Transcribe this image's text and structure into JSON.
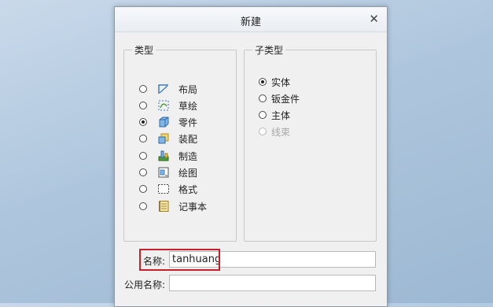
{
  "dialog": {
    "title": "新建",
    "close_glyph": "✕"
  },
  "type_group": {
    "legend": "类型",
    "items": [
      {
        "label": "布局",
        "icon": "layout-icon",
        "selected": false
      },
      {
        "label": "草绘",
        "icon": "sketch-icon",
        "selected": false
      },
      {
        "label": "零件",
        "icon": "part-icon",
        "selected": true
      },
      {
        "label": "装配",
        "icon": "assembly-icon",
        "selected": false
      },
      {
        "label": "制造",
        "icon": "manufacturing-icon",
        "selected": false
      },
      {
        "label": "绘图",
        "icon": "drawing-icon",
        "selected": false
      },
      {
        "label": "格式",
        "icon": "format-icon",
        "selected": false
      },
      {
        "label": "记事本",
        "icon": "notebook-icon",
        "selected": false
      }
    ]
  },
  "subtype_group": {
    "legend": "子类型",
    "items": [
      {
        "label": "实体",
        "selected": true,
        "enabled": true
      },
      {
        "label": "钣金件",
        "selected": false,
        "enabled": true
      },
      {
        "label": "主体",
        "selected": false,
        "enabled": true
      },
      {
        "label": "线束",
        "selected": false,
        "enabled": false
      }
    ]
  },
  "name_field": {
    "label": "名称:",
    "value": "tanhuang"
  },
  "common_name_field": {
    "label": "公用名称:",
    "value": ""
  },
  "colors": {
    "highlight": "#c8202a",
    "icon_blue": "#3a78c2",
    "icon_green": "#4c9a3a",
    "icon_yellow": "#e8c24a"
  }
}
